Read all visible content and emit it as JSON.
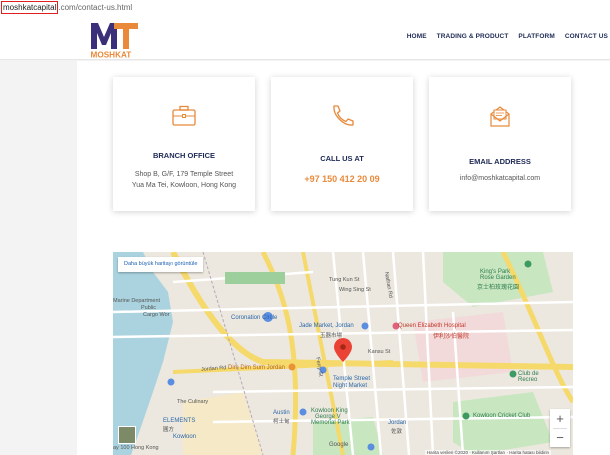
{
  "browser": {
    "url_host": "moshkatcapital",
    "url_path": ".com/contact-us.html"
  },
  "brand": {
    "logo_text": "MOSHKAT",
    "colors": {
      "navy": "#1e2a55",
      "orange": "#e88a3a",
      "purple": "#3c2f7a"
    }
  },
  "nav": {
    "items": [
      "HOME",
      "TRADING & PRODUCT",
      "PLATFORM",
      "CONTACT US"
    ]
  },
  "cards": {
    "branch": {
      "icon": "briefcase-icon",
      "title": "BRANCH OFFICE",
      "line1": "Shop B, G/F, 179 Temple Street",
      "line2": "Yua Ma Tei, Kowloon, Hong Kong"
    },
    "call": {
      "icon": "phone-icon",
      "title": "CALL US AT",
      "phone": "+97 150 412 20 09"
    },
    "email": {
      "icon": "envelope-icon",
      "title": "EMAIL ADDRESS",
      "address": "info@moshkatcapital.com"
    }
  },
  "map": {
    "larger_map": "Daha büyük haritayı görüntüle",
    "attribution": "Harita verileri ©2020 · Kullanım Şartları · Harita hatası bildirin",
    "zoom_in": "+",
    "zoom_out": "−",
    "labels": {
      "coronation": "Coronation Circle",
      "jade": "Jade Market, Jordan",
      "jade_zh": "玉器市場",
      "queen": "Queen Elizabeth Hospital",
      "queen_zh": "伊利沙伯醫院",
      "kings": "King's Park",
      "rose": "Rose Garden",
      "kings_zh": "京士柏玫瑰花園",
      "dimsum": "Dim Dim Sum Jordan",
      "temple": "Temple Street",
      "night": "Night Market",
      "culinary": "The Culinary",
      "elements": "ELEMENTS",
      "elements_zh": "圓方",
      "kowloon": "Kowloon",
      "austin": "Austin",
      "austin_zh": "柯士甸",
      "kingpark": "Kowloon King",
      "george": "George V",
      "memorial": "Memorial Park",
      "jordan": "Jordan",
      "jordan_zh": "佐敦",
      "cricket": "Kowloon Cricket Club",
      "clubde": "Club de",
      "recreo": "Recreo",
      "marine": "Marine Department",
      "hongkong": "ay 100 Hong Kong",
      "nathan": "Nathan Rd",
      "jordan_rd": "Jordan Rd",
      "ferry": "Ferry St",
      "public": "Public",
      "cargo": "Cargo Wor",
      "kansu": "Kansu St",
      "wingsing": "Wing Sing St",
      "tungkun": "Tung Kun St",
      "google": "Google"
    }
  }
}
